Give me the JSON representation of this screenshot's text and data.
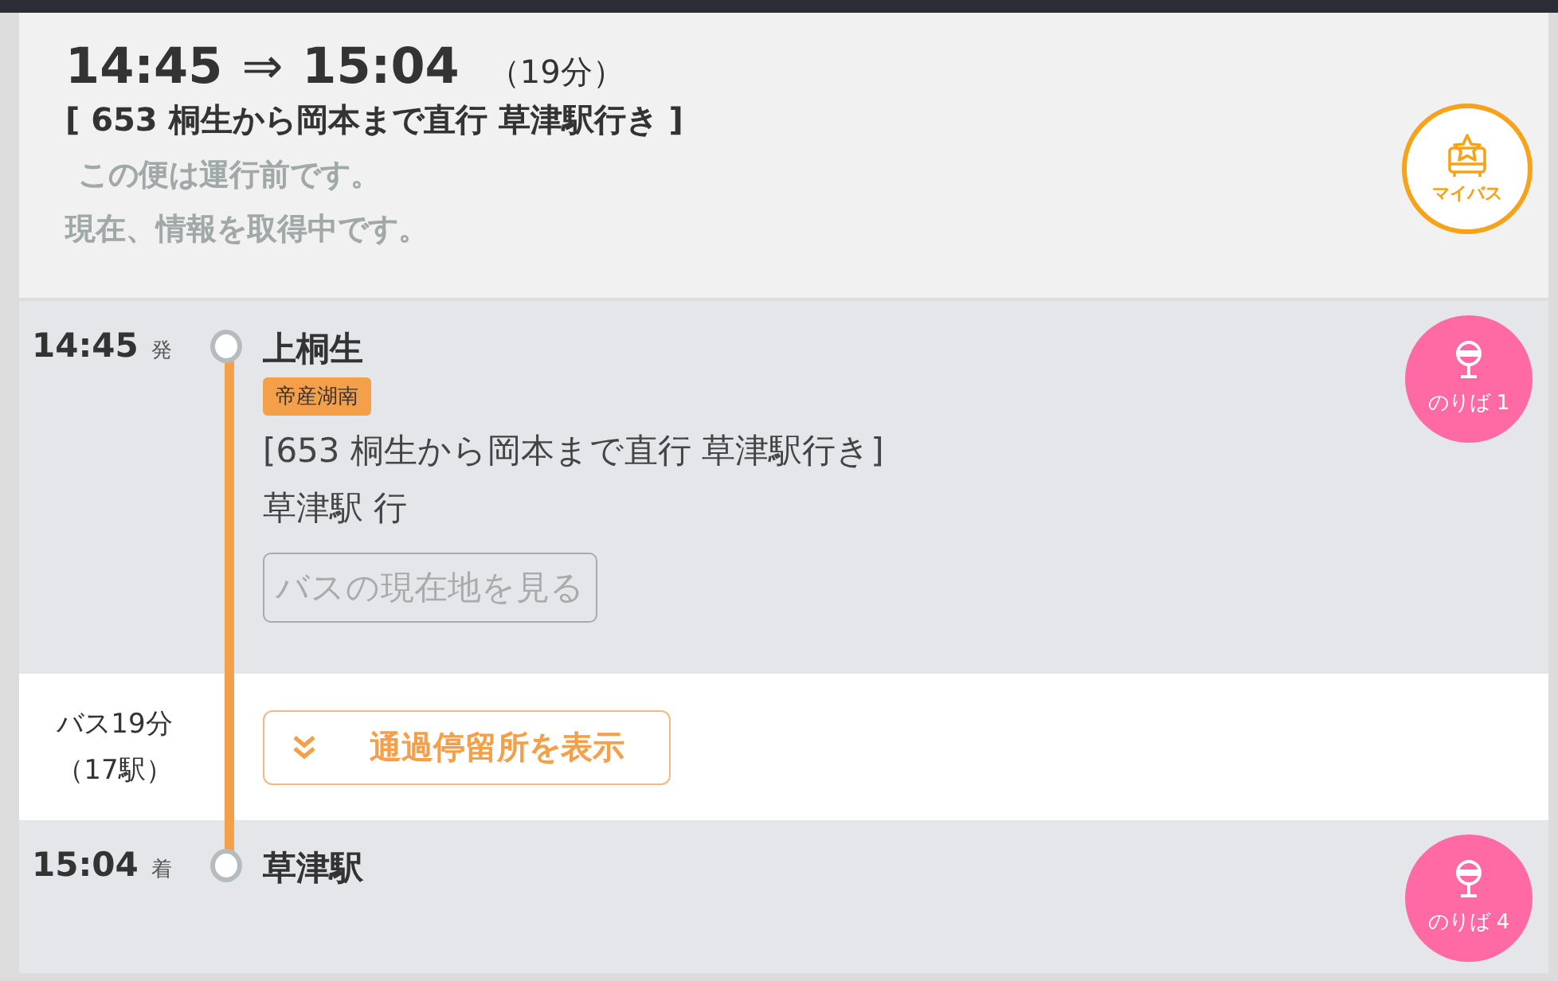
{
  "header": {
    "depart": "14:45",
    "arrow": "⇒",
    "arrive": "15:04",
    "duration": "（19分）",
    "route": "[ 653 桐生から岡本まで直行 草津駅行き ]",
    "status_lines": [
      "この便は運行前です。",
      "現在、情報を取得中です。"
    ],
    "mybus_label": "マイバス"
  },
  "timeline": [
    {
      "kind": "stop",
      "time": "14:45",
      "time_kind": "発",
      "name": "上桐生",
      "operator": "帝産湖南",
      "route": "[653 桐生から岡本まで直行 草津駅行き]",
      "destination": "草津駅 行",
      "location_button": {
        "label": "バスの現在地を見る",
        "disabled": true
      },
      "platform": "のりば 1"
    },
    {
      "kind": "ride",
      "duration": "バス19分",
      "stop_count": "（17駅）",
      "toggle": {
        "label": "通過停留所を表示",
        "expanded": false
      }
    },
    {
      "kind": "stop",
      "time": "15:04",
      "time_kind": "着",
      "name": "草津駅",
      "platform": "のりば 4"
    }
  ]
}
